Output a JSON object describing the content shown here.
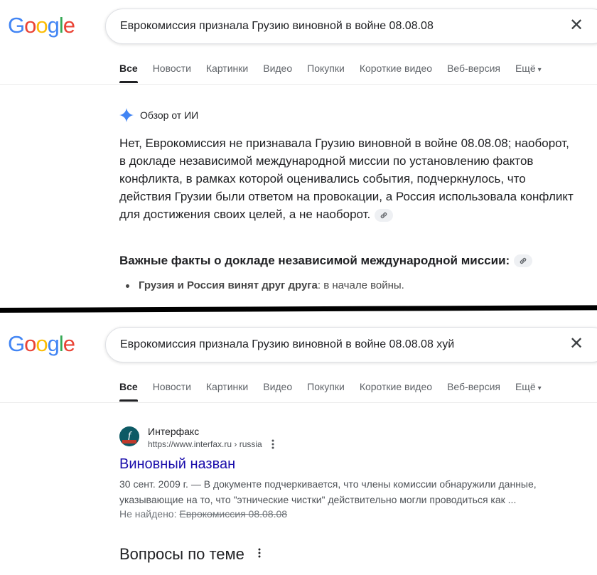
{
  "top": {
    "logo": [
      "G",
      "o",
      "o",
      "g",
      "l",
      "e"
    ],
    "query": "Еврокомиссия признала Грузию виновной в войне 08.08.08",
    "clear_icon": "close-icon",
    "tabs": [
      "Все",
      "Новости",
      "Картинки",
      "Видео",
      "Покупки",
      "Короткие видео",
      "Веб-версия",
      "Ещё"
    ],
    "ai_overview": {
      "label": "Обзор от ИИ",
      "paragraph": "Нет, Еврокомиссия не признавала Грузию виновной в войне 08.08.08; наоборот, в докладе независимой международной миссии по установлению фактов конфликта, в рамках которой оценивались события, подчеркнулось, что действия Грузии были ответом на провокации, а Россия использовала конфликт для достижения своих целей, а не наоборот.",
      "subheading": "Важные факты о докладе независимой международной миссии:",
      "bullet_strong": "Грузия и Россия винят друг друга",
      "bullet_rest": ": в начале войны."
    }
  },
  "bottom": {
    "logo": [
      "G",
      "o",
      "o",
      "g",
      "l",
      "e"
    ],
    "query": "Еврокомиссия признала Грузию виновной в войне 08.08.08 хуй",
    "tabs": [
      "Все",
      "Новости",
      "Картинки",
      "Видео",
      "Покупки",
      "Короткие видео",
      "Веб-версия",
      "Ещё"
    ],
    "result": {
      "site_name": "Интерфакс",
      "url": "https://www.interfax.ru › russia",
      "title": "Виновный назван",
      "snippet": "30 сент. 2009 г. — В документе подчеркивается, что члены комиссии обнаружили данные, указывающие на то, что \"этнические чистки\" действительно могли проводиться как ...",
      "missing_label": "Не найдено: ",
      "missing_terms": "Еврокомиссия 08.08.08"
    },
    "related_heading": "Вопросы по теме"
  },
  "colors": {
    "link_blue": "#1a0dab",
    "google_blue": "#4285F4",
    "google_red": "#EA4335",
    "google_yellow": "#FBBC05",
    "google_green": "#34A853"
  }
}
